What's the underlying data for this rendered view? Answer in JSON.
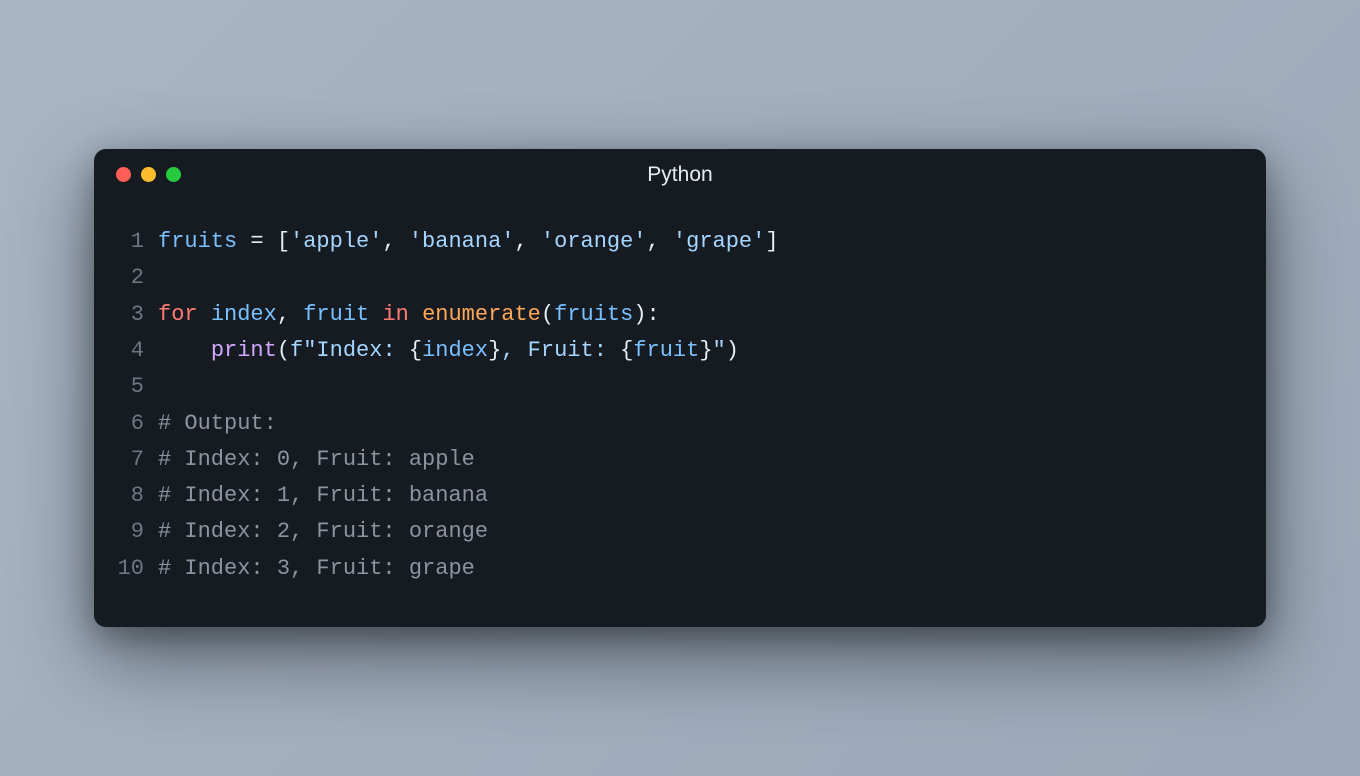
{
  "window": {
    "title": "Python"
  },
  "code": {
    "lines": [
      {
        "n": "1",
        "tokens": [
          {
            "t": "name",
            "v": "fruits"
          },
          {
            "t": "op",
            "v": " = "
          },
          {
            "t": "punct",
            "v": "["
          },
          {
            "t": "str",
            "v": "'apple'"
          },
          {
            "t": "punct",
            "v": ", "
          },
          {
            "t": "str",
            "v": "'banana'"
          },
          {
            "t": "punct",
            "v": ", "
          },
          {
            "t": "str",
            "v": "'orange'"
          },
          {
            "t": "punct",
            "v": ", "
          },
          {
            "t": "str",
            "v": "'grape'"
          },
          {
            "t": "punct",
            "v": "]"
          }
        ]
      },
      {
        "n": "2",
        "tokens": []
      },
      {
        "n": "3",
        "tokens": [
          {
            "t": "kw",
            "v": "for"
          },
          {
            "t": "op",
            "v": " "
          },
          {
            "t": "name",
            "v": "index"
          },
          {
            "t": "punct",
            "v": ", "
          },
          {
            "t": "name",
            "v": "fruit"
          },
          {
            "t": "op",
            "v": " "
          },
          {
            "t": "kw",
            "v": "in"
          },
          {
            "t": "op",
            "v": " "
          },
          {
            "t": "builtin",
            "v": "enumerate"
          },
          {
            "t": "punct",
            "v": "("
          },
          {
            "t": "name",
            "v": "fruits"
          },
          {
            "t": "punct",
            "v": "):"
          }
        ]
      },
      {
        "n": "4",
        "tokens": [
          {
            "t": "op",
            "v": "    "
          },
          {
            "t": "func",
            "v": "print"
          },
          {
            "t": "punct",
            "v": "("
          },
          {
            "t": "fstr",
            "v": "f\"Index: "
          },
          {
            "t": "punct",
            "v": "{"
          },
          {
            "t": "interp",
            "v": "index"
          },
          {
            "t": "punct",
            "v": "}"
          },
          {
            "t": "fstr",
            "v": ", Fruit: "
          },
          {
            "t": "punct",
            "v": "{"
          },
          {
            "t": "interp",
            "v": "fruit"
          },
          {
            "t": "punct",
            "v": "}"
          },
          {
            "t": "fstr",
            "v": "\""
          },
          {
            "t": "punct",
            "v": ")"
          }
        ]
      },
      {
        "n": "5",
        "tokens": []
      },
      {
        "n": "6",
        "tokens": [
          {
            "t": "comment",
            "v": "# Output:"
          }
        ]
      },
      {
        "n": "7",
        "tokens": [
          {
            "t": "comment",
            "v": "# Index: 0, Fruit: apple"
          }
        ]
      },
      {
        "n": "8",
        "tokens": [
          {
            "t": "comment",
            "v": "# Index: 1, Fruit: banana"
          }
        ]
      },
      {
        "n": "9",
        "tokens": [
          {
            "t": "comment",
            "v": "# Index: 2, Fruit: orange"
          }
        ]
      },
      {
        "n": "10",
        "tokens": [
          {
            "t": "comment",
            "v": "# Index: 3, Fruit: grape"
          }
        ]
      }
    ]
  }
}
